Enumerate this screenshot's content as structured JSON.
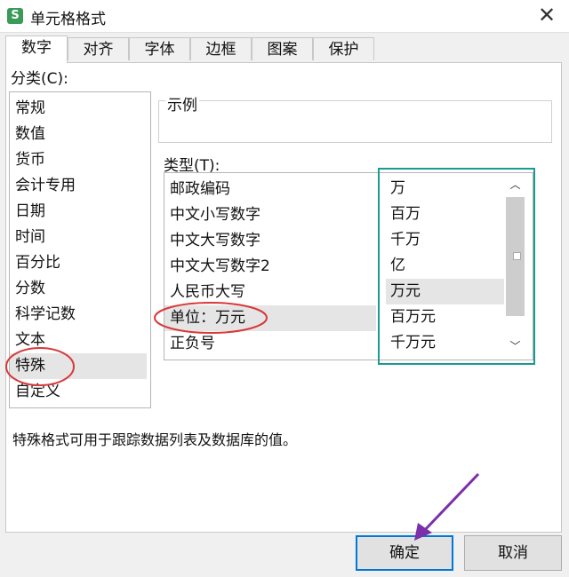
{
  "window": {
    "title": "单元格格式",
    "app_icon_glyph": "S",
    "close_glyph": "✕"
  },
  "tabs": [
    {
      "label": "数字",
      "active": true
    },
    {
      "label": "对齐"
    },
    {
      "label": "字体"
    },
    {
      "label": "边框"
    },
    {
      "label": "图案"
    },
    {
      "label": "保护"
    }
  ],
  "category": {
    "label": "分类(C):",
    "items": [
      "常规",
      "数值",
      "货币",
      "会计专用",
      "日期",
      "时间",
      "百分比",
      "分数",
      "科学记数",
      "文本",
      "特殊",
      "自定义"
    ],
    "selected": "特殊"
  },
  "sample": {
    "label": "示例",
    "value": ""
  },
  "type": {
    "label": "类型(T):",
    "items": [
      "邮政编码",
      "中文小写数字",
      "中文大写数字",
      "中文大写数字2",
      "人民币大写",
      "单位：万元",
      "正负号"
    ],
    "selected": "单位：万元"
  },
  "units": {
    "items": [
      "万",
      "百万",
      "千万",
      "亿",
      "万元",
      "百万元",
      "千万元"
    ],
    "selected": "万元"
  },
  "scrollbar": {
    "up_glyph": "︿",
    "down_glyph": "﹀"
  },
  "description": "特殊格式可用于跟踪数据列表及数据库的值。",
  "buttons": {
    "ok": "确定",
    "cancel": "取消"
  },
  "colors": {
    "highlight_frame": "#1a9a92",
    "annotation_circle": "#d9383a",
    "annotation_arrow": "#7b2fa8",
    "default_button": "#0078d7"
  }
}
